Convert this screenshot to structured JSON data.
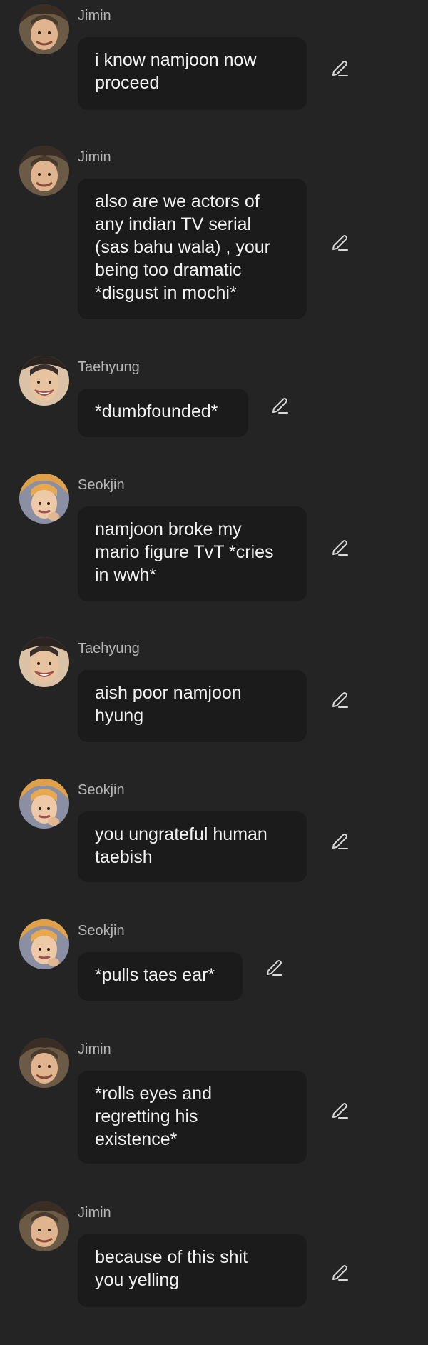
{
  "colors": {
    "background": "#242424",
    "bubble": "#1b1b1b",
    "message_text": "#f2f2f2",
    "sender_text": "#b5b5b5",
    "edit_icon": "#d8d8d8"
  },
  "messages": [
    {
      "sender": "Jimin",
      "avatar": "jimin-avatar",
      "text": "i know namjoon now\nproceed"
    },
    {
      "sender": "Jimin",
      "avatar": "jimin-avatar",
      "text": "also are we actors of\nany indian TV serial\n(sas bahu wala) , your\nbeing too dramatic\n*disgust in mochi*"
    },
    {
      "sender": "Taehyung",
      "avatar": "taehyung-avatar",
      "text": "*dumbfounded*"
    },
    {
      "sender": "Seokjin",
      "avatar": "seokjin-avatar",
      "text": "namjoon broke my\nmario figure TvT *cries\nin wwh*"
    },
    {
      "sender": "Taehyung",
      "avatar": "taehyung-avatar",
      "text": "aish poor namjoon\nhyung"
    },
    {
      "sender": "Seokjin",
      "avatar": "seokjin-avatar",
      "text": "you ungrateful human\ntaebish"
    },
    {
      "sender": "Seokjin",
      "avatar": "seokjin-avatar",
      "text": "*pulls taes ear*"
    },
    {
      "sender": "Jimin",
      "avatar": "jimin-avatar",
      "text": "*rolls eyes and\nregretting his\nexistence*"
    },
    {
      "sender": "Jimin",
      "avatar": "jimin-avatar",
      "text": "because of this shit\nyou yelling"
    }
  ]
}
